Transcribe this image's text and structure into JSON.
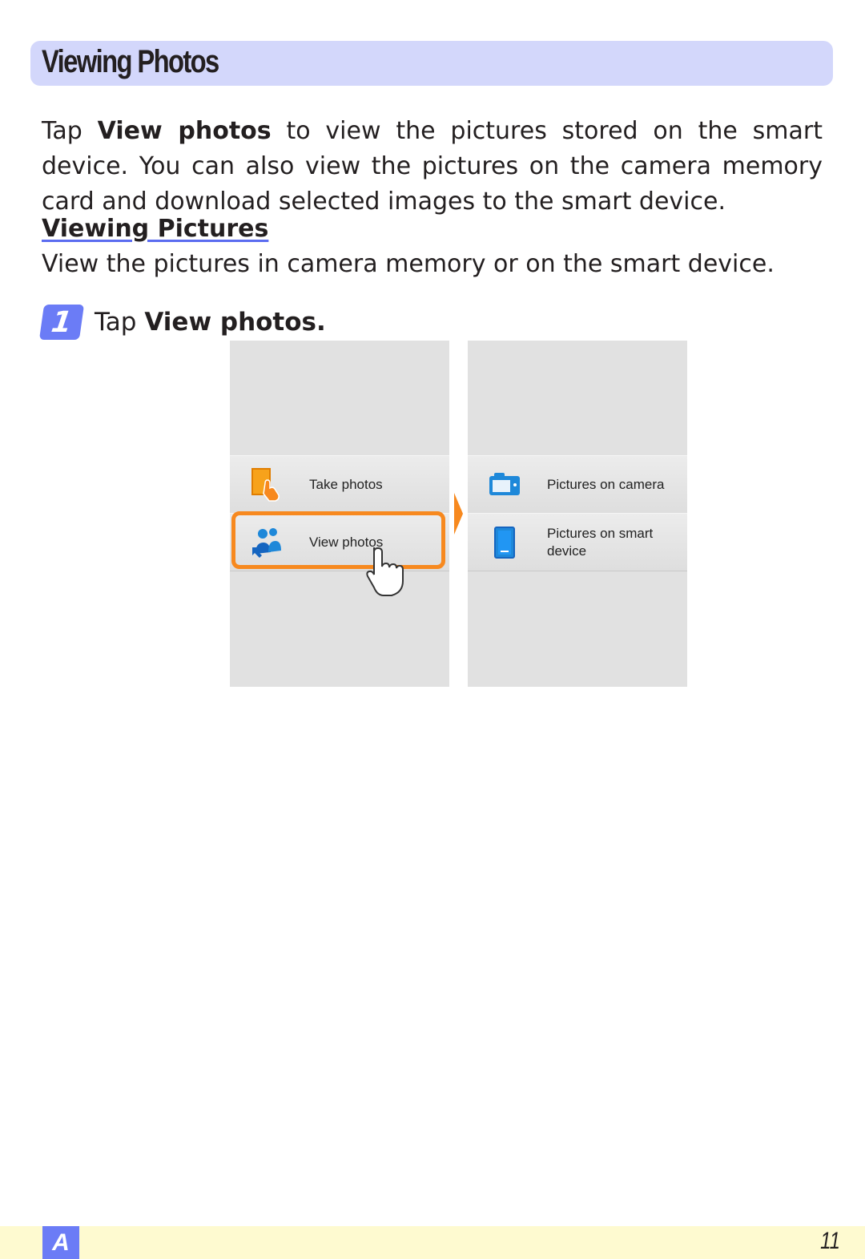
{
  "title": "Viewing Photos",
  "intro": {
    "prefix": "Tap ",
    "bold": "View photos",
    "suffix": " to view the pictures stored on the smart device. You can also view the pictures on the camera memory card and download selected images to the smart device."
  },
  "section": {
    "heading": "Viewing Pictures",
    "text": "View the pictures in camera memory or on the smart device."
  },
  "step": {
    "number": "1",
    "prefix": "Tap ",
    "bold": "View photos",
    "suffix": "."
  },
  "screen_left": {
    "items": [
      {
        "label": "Take photos",
        "icon": "take-photos-icon"
      },
      {
        "label": "View photos",
        "icon": "view-photos-icon"
      }
    ]
  },
  "screen_right": {
    "items": [
      {
        "label": "Pictures on camera",
        "icon": "camera-icon"
      },
      {
        "label": "Pictures on smart device",
        "icon": "smart-device-icon"
      }
    ]
  },
  "colors": {
    "title_bg": "#d3d7fb",
    "accent_blue": "#6b7cf6",
    "highlight_orange": "#f7891f",
    "footer_bg": "#fefad0"
  },
  "footer": {
    "tab_label": "A",
    "page_number": "11"
  }
}
